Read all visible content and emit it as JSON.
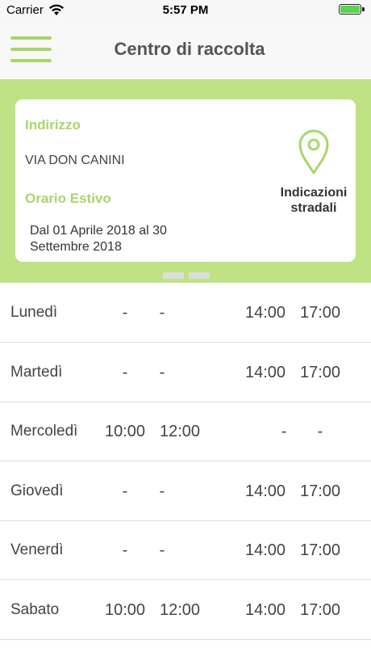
{
  "status_bar": {
    "carrier": "Carrier",
    "time": "5:57 PM"
  },
  "header": {
    "title": "Centro di raccolta"
  },
  "card": {
    "address_label": "Indirizzo",
    "address": "VIA DON CANINI",
    "schedule_label": "Orario Estivo",
    "period_line1": "Dal 01 Aprile 2018 al 30",
    "period_line2": "Settembre 2018",
    "directions_line1": "Indicazioni",
    "directions_line2": "stradali"
  },
  "colors": {
    "accent": "#a9d66b",
    "band": "#bfe384"
  },
  "schedule": [
    {
      "day": "Lunedì",
      "am_open": "-",
      "am_close": "-",
      "pm_open": "14:00",
      "pm_close": "17:00"
    },
    {
      "day": "Martedì",
      "am_open": "-",
      "am_close": "-",
      "pm_open": "14:00",
      "pm_close": "17:00"
    },
    {
      "day": "Mercoledì",
      "am_open": "10:00",
      "am_close": "12:00",
      "pm_open": "-",
      "pm_close": "-"
    },
    {
      "day": "Giovedì",
      "am_open": "-",
      "am_close": "-",
      "pm_open": "14:00",
      "pm_close": "17:00"
    },
    {
      "day": "Venerdì",
      "am_open": "-",
      "am_close": "-",
      "pm_open": "14:00",
      "pm_close": "17:00"
    },
    {
      "day": "Sabato",
      "am_open": "10:00",
      "am_close": "12:00",
      "pm_open": "14:00",
      "pm_close": "17:00"
    }
  ]
}
